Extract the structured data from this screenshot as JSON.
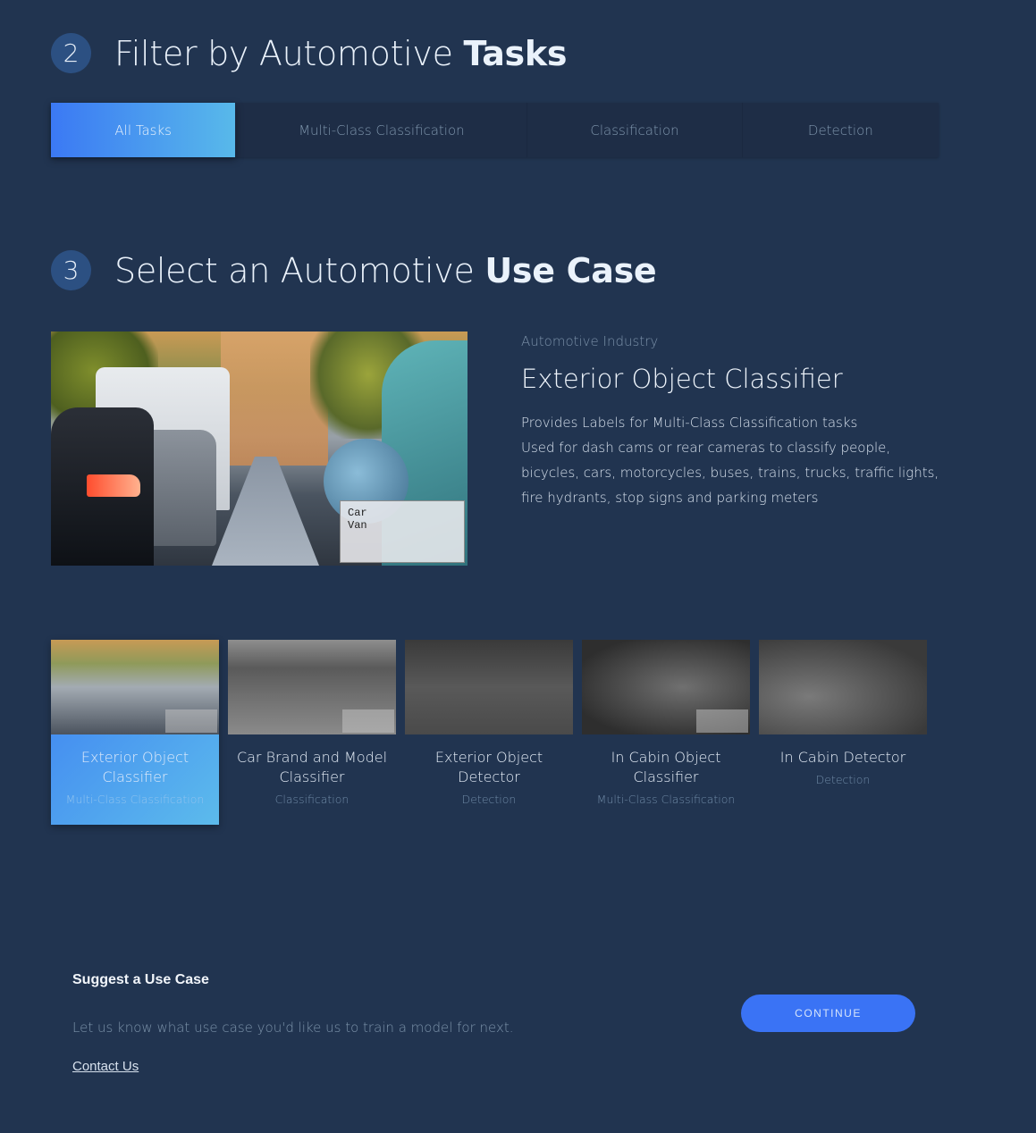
{
  "step2": {
    "number": "2",
    "title_prefix": "Filter by Automotive ",
    "title_bold": "Tasks"
  },
  "tabs": [
    {
      "label": "All Tasks",
      "active": true
    },
    {
      "label": "Multi-Class Classification",
      "active": false
    },
    {
      "label": "Classification",
      "active": false
    },
    {
      "label": "Detection",
      "active": false
    }
  ],
  "step3": {
    "number": "3",
    "title_prefix": "Select an Automotive ",
    "title_bold": "Use Case"
  },
  "selected": {
    "image_labels": [
      "Car",
      "Van"
    ],
    "industry": "Automotive Industry",
    "title": "Exterior Object Classifier",
    "description_line1": "Provides Labels  for Multi-Class Classification tasks",
    "description_line2": "Used for dash cams or rear cameras to classify people, bicycles, cars, motorcycles, buses, trains, trucks, traffic lights, fire hydrants, stop signs and parking meters"
  },
  "use_cases": [
    {
      "title": "Exterior Object Classifier",
      "type": "Multi-Class Classification",
      "active": true
    },
    {
      "title": "Car Brand and Model Classifier",
      "type": "Classification",
      "active": false
    },
    {
      "title": "Exterior Object Detector",
      "type": "Detection",
      "active": false
    },
    {
      "title": "In Cabin Object Classifier",
      "type": "Multi-Class Classification",
      "active": false
    },
    {
      "title": "In Cabin Detector",
      "type": "Detection",
      "active": false
    }
  ],
  "footer": {
    "suggest_title": "Suggest a Use Case",
    "suggest_text": "Let us know what use case you'd like us to train a model for next.",
    "contact_label": "Contact Us",
    "continue_label": "CONTINUE"
  },
  "colors": {
    "background": "#213450",
    "accent_start": "#3b79f4",
    "accent_end": "#58b9ea",
    "button": "#3a73f5"
  }
}
